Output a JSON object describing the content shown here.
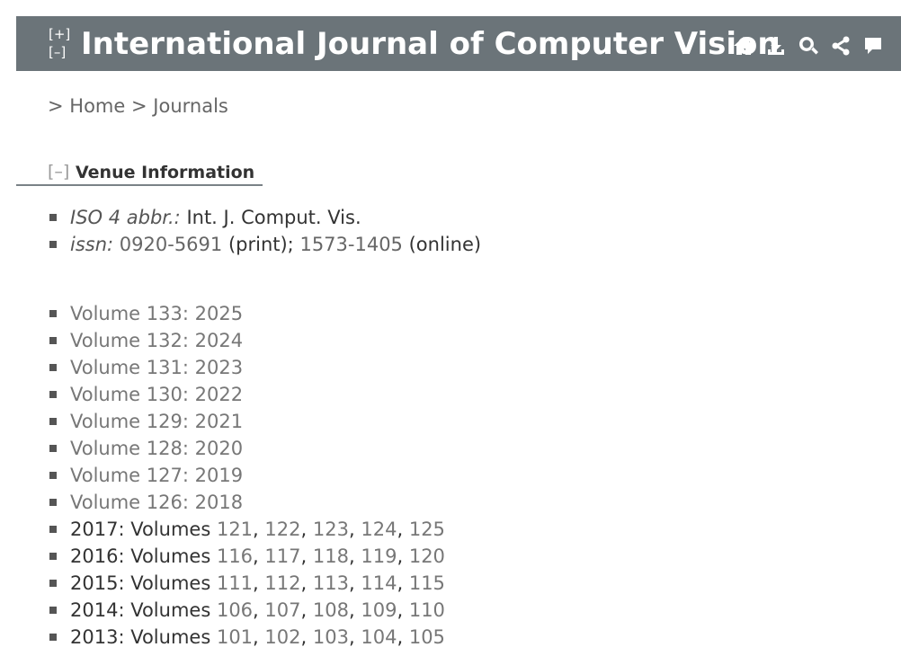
{
  "header": {
    "expand": "[+]",
    "collapse": "[–]",
    "title": "International Journal of Computer Vision",
    "icons": [
      "home-icon",
      "download-icon",
      "search-icon",
      "share-icon",
      "comment-icon"
    ],
    "bg_color": "#6b7479"
  },
  "breadcrumb": {
    "sep1": ">",
    "home": "Home",
    "sep2": ">",
    "journals": "Journals"
  },
  "venue": {
    "toggle": "[–]",
    "title": "Venue Information",
    "iso_label": "ISO 4 abbr.:",
    "iso_value": "Int. J. Comput. Vis.",
    "issn_label": "issn:",
    "issn_print": "0920-5691",
    "issn_print_suffix": "(print);",
    "issn_online": "1573-1405",
    "issn_online_suffix": "(online)"
  },
  "volumes": [
    "Volume 133: 2025",
    "Volume 132: 2024",
    "Volume 131: 2023",
    "Volume 130: 2022",
    "Volume 129: 2021",
    "Volume 128: 2020",
    "Volume 127: 2019",
    "Volume 126: 2018"
  ],
  "years": [
    {
      "year": "2017:",
      "label": "Volumes",
      "vols": [
        "121",
        "122",
        "123",
        "124",
        "125"
      ]
    },
    {
      "year": "2016:",
      "label": "Volumes",
      "vols": [
        "116",
        "117",
        "118",
        "119",
        "120"
      ]
    },
    {
      "year": "2015:",
      "label": "Volumes",
      "vols": [
        "111",
        "112",
        "113",
        "114",
        "115"
      ]
    },
    {
      "year": "2014:",
      "label": "Volumes",
      "vols": [
        "106",
        "107",
        "108",
        "109",
        "110"
      ]
    },
    {
      "year": "2013:",
      "label": "Volumes",
      "vols": [
        "101",
        "102",
        "103",
        "104",
        "105"
      ]
    }
  ]
}
